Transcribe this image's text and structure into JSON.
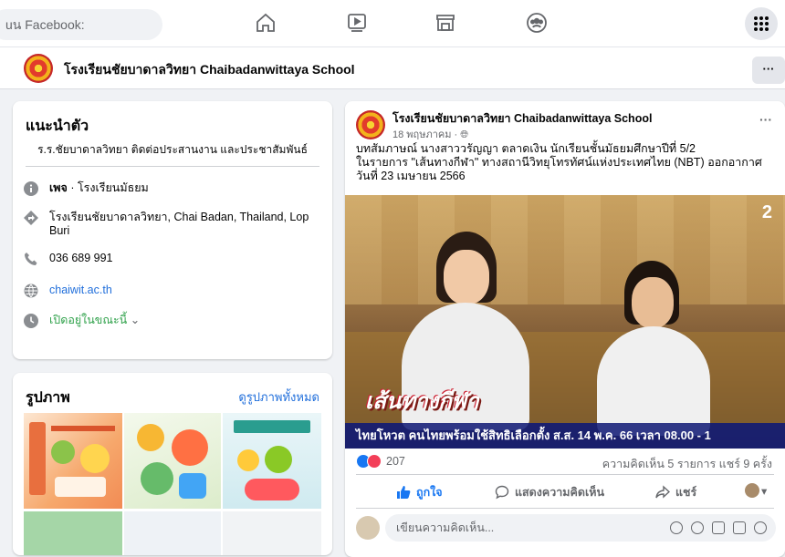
{
  "topnav": {
    "search_text": "uน Facebook:",
    "icons": [
      "home-icon",
      "watch-icon",
      "marketplace-icon",
      "groups-icon",
      "menu-grid-icon"
    ]
  },
  "pagebar": {
    "title": "โรงเรียนชัยบาดาลวิทยา Chaibadanwittaya School",
    "more_label": "···"
  },
  "intro": {
    "heading": "แนะนำตัว",
    "bio": "ร.ร.ชัยบาดาลวิทยา ติดต่อประสานงาน และประชาสัมพันธ์",
    "page_type_bold": "เพจ",
    "page_type_rest": " · โรงเรียนมัธยม",
    "address": "โรงเรียนชัยบาดาลวิทยา, Chai Badan, Thailand, Lop Buri",
    "phone": "036 689 991",
    "website": "chaiwit.ac.th",
    "hours": "เปิดอยู่ในขณะนี้",
    "hours_color": "#31a24c",
    "link_color": "#216fdb"
  },
  "photos": {
    "heading": "รูปภาพ",
    "see_all": "ดูรูปภาพทั้งหมด"
  },
  "post": {
    "author": "โรงเรียนชัยบาดาลวิทยา Chaibadanwittaya School",
    "date": "18 พฤษภาคม · ",
    "more": "···",
    "text_line1": "บทสัมภาษณ์ นางสาววรัญญา ตลาดเงิน นักเรียนชั้นมัธยมศึกษาปีที่ 5/2",
    "text_line2": "ในรายการ \"เส้นทางกีฬา\" ทางสถานีวิทยุโทรทัศน์แห่งประเทศไทย (NBT) ออกอากาศวันที่ 23 เมษายน 2566",
    "video": {
      "show_name": "เส้นทางกีฬา",
      "ticker": "ไทยโหวต คนไทยพร้อมใช้สิทธิเลือกตั้ง ส.ส. 14 พ.ค. 66 เวลา 08.00 - 1",
      "channel": "2"
    },
    "reaction_count": "207",
    "stats": "ความคิดเห็น 5 รายการ  แชร์ 9 ครั้ง",
    "actions": {
      "like": "ถูกใจ",
      "comment": "แสดงความคิดเห็น",
      "share": "แชร์"
    },
    "comment_placeholder": "เขียนความคิดเห็น..."
  }
}
